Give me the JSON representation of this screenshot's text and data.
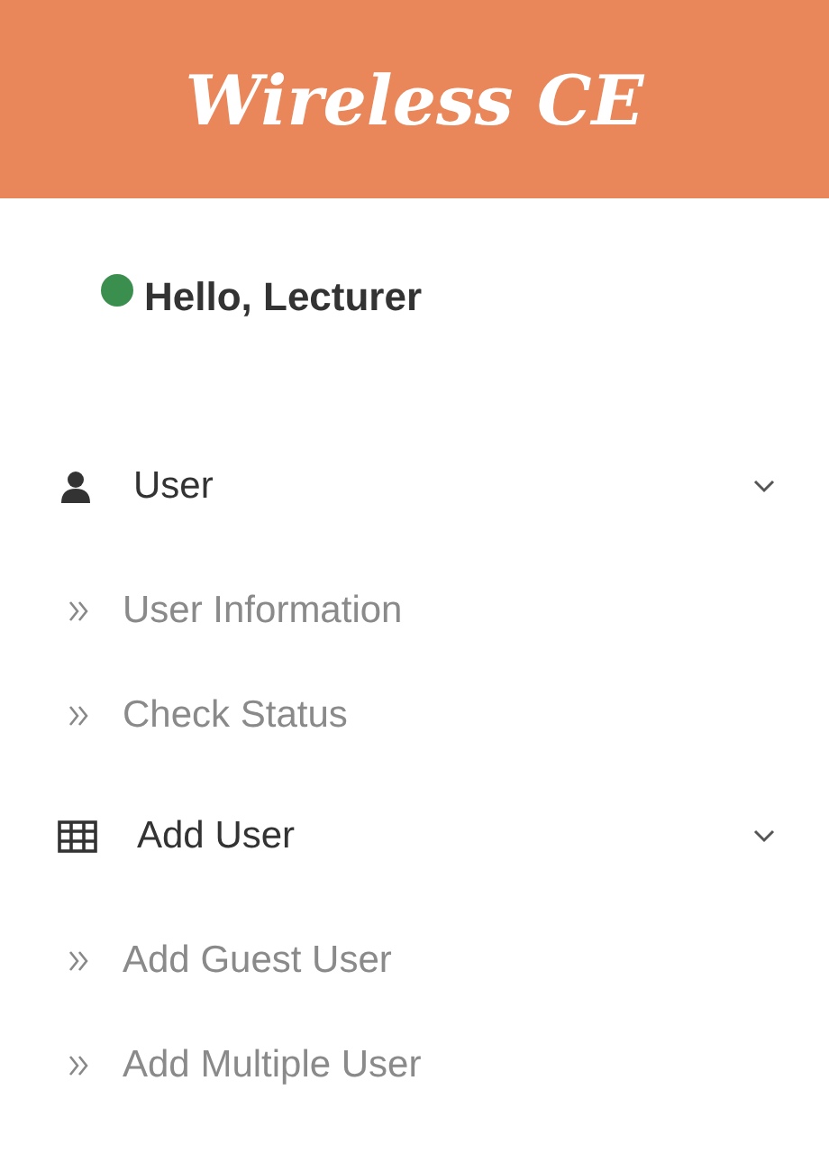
{
  "header": {
    "title": "Wireless CE"
  },
  "greeting": {
    "text": "Hello, Lecturer"
  },
  "menu": [
    {
      "label": "User",
      "expanded": true,
      "children": [
        {
          "label": "User Information"
        },
        {
          "label": "Check Status"
        }
      ]
    },
    {
      "label": "Add User",
      "expanded": true,
      "children": [
        {
          "label": "Add Guest User"
        },
        {
          "label": "Add Multiple User"
        }
      ]
    }
  ]
}
